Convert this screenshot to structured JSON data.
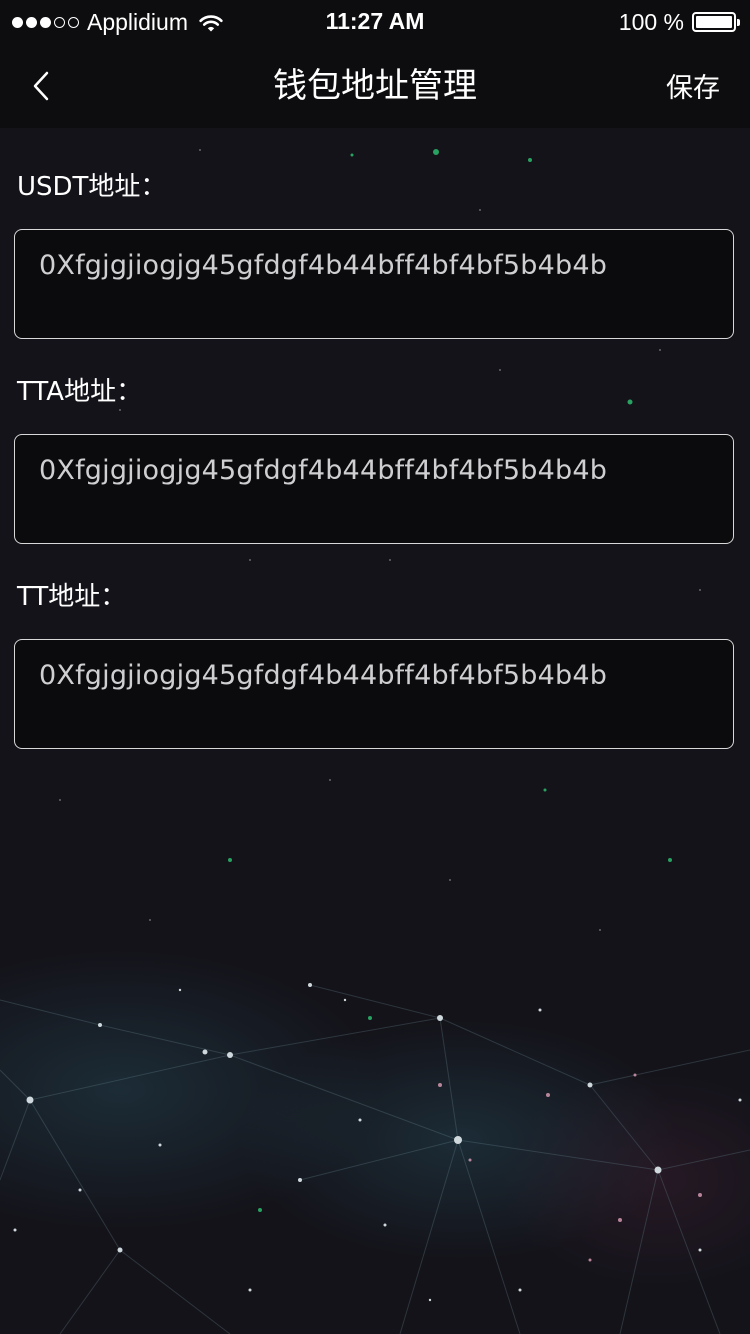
{
  "status_bar": {
    "signal_filled": 3,
    "signal_total": 5,
    "carrier": "Applidium",
    "wifi_icon": "wifi-icon",
    "time": "11:27 AM",
    "battery_text": "100 %",
    "battery_level": 1.0
  },
  "nav": {
    "back_icon": "chevron-left-icon",
    "title": "钱包地址管理",
    "save_label": "保存"
  },
  "fields": [
    {
      "label": "USDT地址：",
      "value": "0Xfgjgjiogjg45gfdgf4b44bff4bf4bf5b4b4b"
    },
    {
      "label": "TTA地址：",
      "value": "0Xfgjgjiogjg45gfdgf4b44bff4bf4bf5b4b4b"
    },
    {
      "label": "TT地址：",
      "value": "0Xfgjgjiogjg45gfdgf4b44bff4bf4bf5b4b4b"
    }
  ],
  "colors": {
    "background": "#14131a",
    "bar_background": "#0d0d0f",
    "field_border": "#d8d8d8",
    "field_text": "#cfcfd2",
    "text": "#ffffff"
  }
}
